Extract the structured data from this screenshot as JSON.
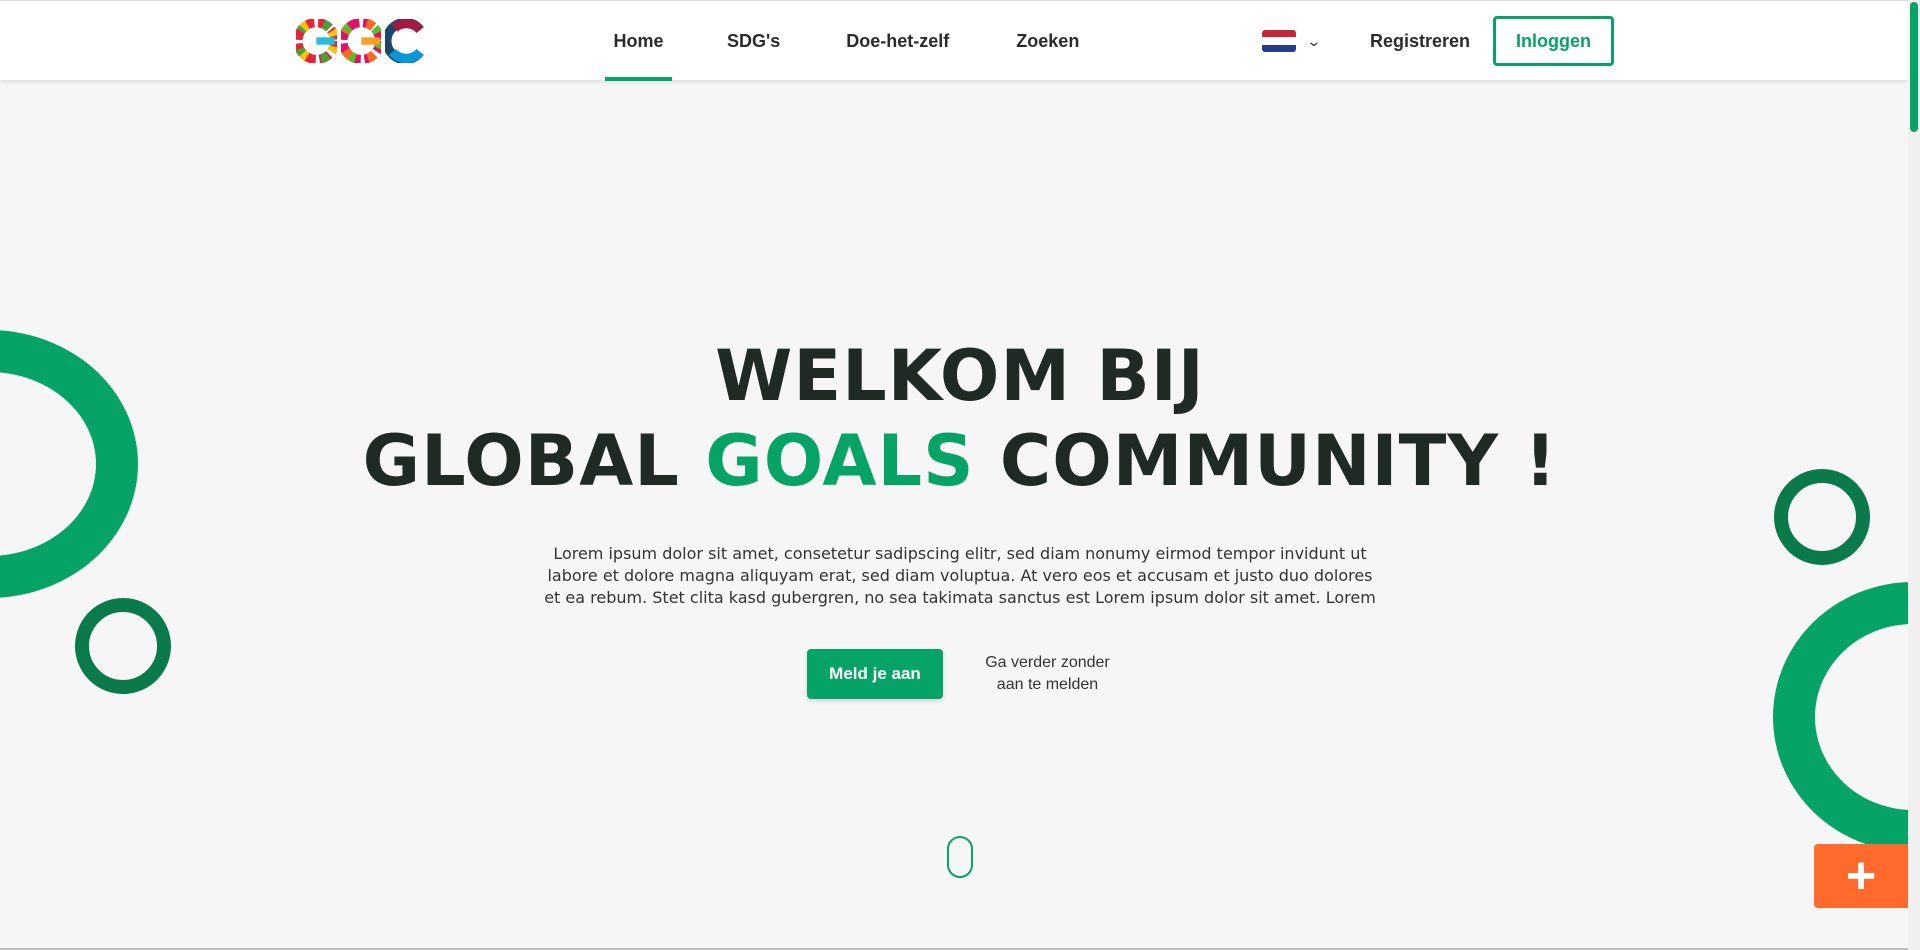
{
  "header": {
    "logo_alt": "GGC",
    "nav": [
      {
        "label": "Home",
        "active": true
      },
      {
        "label": "SDG's",
        "active": false
      },
      {
        "label": "Doe-het-zelf",
        "active": false
      },
      {
        "label": "Zoeken",
        "active": false
      }
    ],
    "language_icon": "netherlands-flag-icon",
    "register_label": "Registreren",
    "login_label": "Inloggen"
  },
  "hero": {
    "title_line1": "WELKOM BIJ",
    "title_line2_prefix": "GLOBAL ",
    "title_line2_highlight": "GOALS",
    "title_line2_suffix": " COMMUNITY !",
    "body": "Lorem ipsum dolor sit amet, consetetur sadipscing elitr, sed diam nonumy eirmod tempor invidunt ut labore et dolore magna aliquyam erat, sed diam voluptua. At vero eos et accusam et justo duo dolores et ea rebum. Stet clita kasd gubergren, no sea takimata sanctus est Lorem ipsum dolor sit amet. Lorem",
    "cta_label": "Meld je aan",
    "skip_label": "Ga verder zonder aan te melden"
  },
  "fab_icon": "plus-icon",
  "colors": {
    "accent": "#06a367",
    "dark_green": "#0a7a4a",
    "orange": "#ff6b2c",
    "text_dark": "#1f2a24"
  }
}
